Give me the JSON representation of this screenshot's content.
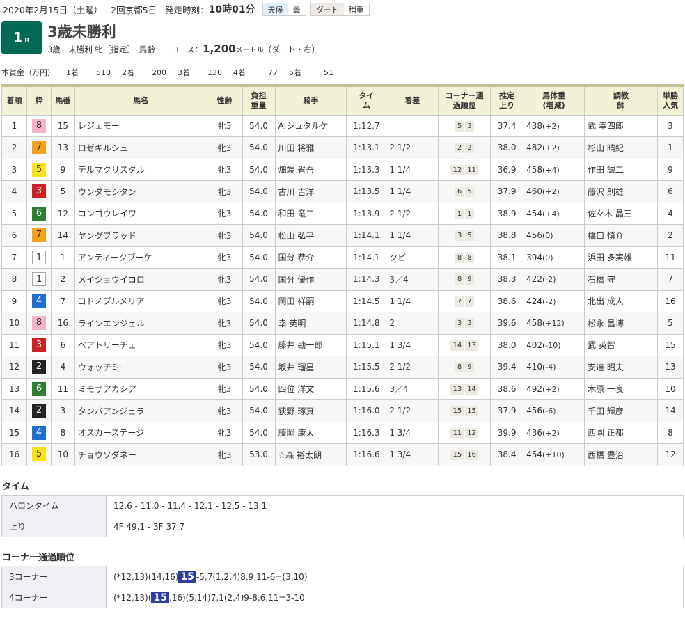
{
  "header": {
    "date": "2020年2月15日（土曜）",
    "meeting": "2回京都5日",
    "start_label": "発走時刻：",
    "start_time": "10時01分",
    "weather_label": "天候",
    "weather": "曇",
    "track_label": "ダート",
    "track_cond": "稍重"
  },
  "race": {
    "number": "1",
    "number_suffix": "R",
    "title": "3歳未勝利",
    "conditions": "3歳　未勝利 牝［指定］　馬齢",
    "course_label": "コース：",
    "distance": "1,200",
    "distance_unit": "メートル",
    "course_detail": "（ダート・右）"
  },
  "prize": {
    "label": "本賞金（万円）",
    "items": [
      {
        "place": "1着",
        "amount": "510"
      },
      {
        "place": "2着",
        "amount": "200"
      },
      {
        "place": "3着",
        "amount": "130"
      },
      {
        "place": "4着",
        "amount": "77"
      },
      {
        "place": "5着",
        "amount": "51"
      }
    ]
  },
  "columns": [
    "着順",
    "枠",
    "馬番",
    "馬名",
    "性齢",
    "負担重量",
    "騎手",
    "タイム",
    "着差",
    "コーナー通過順位",
    "推定上り",
    "馬体重(増減)",
    "調教師",
    "単勝人気"
  ],
  "frame_colors": {
    "1": "#ffffff",
    "2": "#222222",
    "3": "#cc2222",
    "4": "#1e6fd0",
    "5": "#f7e21c",
    "6": "#2e7d32",
    "7": "#f5a11c",
    "8": "#f6b3cb"
  },
  "results": [
    [
      "1",
      "8",
      "15",
      "レジェモー",
      "牝3",
      "54.0",
      "A.シュタルケ",
      "1:12.7",
      "",
      "5",
      "3",
      "37.4",
      "438",
      "(+2)",
      "武 幸四郎",
      "3"
    ],
    [
      "2",
      "7",
      "13",
      "ロゼキルシュ",
      "牝3",
      "54.0",
      "川田 将雅",
      "1:13.1",
      "2 1/2",
      "2",
      "2",
      "38.0",
      "482",
      "(+2)",
      "杉山 晴紀",
      "1"
    ],
    [
      "3",
      "5",
      "9",
      "デルマクリスタル",
      "牝3",
      "54.0",
      "畑端 省吾",
      "1:13.3",
      "1 1/4",
      "12",
      "11",
      "36.9",
      "458",
      "(+4)",
      "作田 誠二",
      "9"
    ],
    [
      "4",
      "3",
      "5",
      "ウンダモシタン",
      "牝3",
      "54.0",
      "古川 吉洋",
      "1:13.5",
      "1 1/4",
      "6",
      "5",
      "37.9",
      "460",
      "(+2)",
      "藤沢 則雄",
      "6"
    ],
    [
      "5",
      "6",
      "12",
      "コンゴウレイワ",
      "牝3",
      "54.0",
      "和田 竜二",
      "1:13.9",
      "2 1/2",
      "1",
      "1",
      "38.9",
      "454",
      "(+4)",
      "佐々木 晶三",
      "4"
    ],
    [
      "6",
      "7",
      "14",
      "ヤングブラッド",
      "牝3",
      "54.0",
      "松山 弘平",
      "1:14.1",
      "1 1/4",
      "3",
      "5",
      "38.8",
      "456",
      "(0)",
      "橋口 慎介",
      "2"
    ],
    [
      "7",
      "1",
      "1",
      "アンティークブーケ",
      "牝3",
      "54.0",
      "国分 恭介",
      "1:14.1",
      "クビ",
      "8",
      "8",
      "38.1",
      "394",
      "(0)",
      "浜田 多実雄",
      "11"
    ],
    [
      "8",
      "1",
      "2",
      "メイショウイコロ",
      "牝3",
      "54.0",
      "国分 優作",
      "1:14.3",
      "3／4",
      "8",
      "9",
      "38.3",
      "422",
      "(-2)",
      "石橋 守",
      "7"
    ],
    [
      "9",
      "4",
      "7",
      "ヨドノプルメリア",
      "牝3",
      "54.0",
      "岡田 祥嗣",
      "1:14.5",
      "1 1/4",
      "7",
      "7",
      "38.6",
      "424",
      "(-2)",
      "北出 成人",
      "16"
    ],
    [
      "10",
      "8",
      "16",
      "ラインエンジェル",
      "牝3",
      "54.0",
      "幸 英明",
      "1:14.8",
      "2",
      "3",
      "3",
      "39.6",
      "458",
      "(+12)",
      "松永 昌博",
      "5"
    ],
    [
      "11",
      "3",
      "6",
      "ベアトリーチェ",
      "牝3",
      "54.0",
      "藤井 勘一郎",
      "1:15.1",
      "1 3/4",
      "14",
      "13",
      "38.0",
      "402",
      "(-10)",
      "武 英智",
      "15"
    ],
    [
      "12",
      "2",
      "4",
      "ウォッチミー",
      "牝3",
      "54.0",
      "坂井 瑠星",
      "1:15.5",
      "2 1/2",
      "8",
      "9",
      "39.4",
      "410",
      "(-4)",
      "安達 昭夫",
      "13"
    ],
    [
      "13",
      "6",
      "11",
      "ミモザアカシア",
      "牝3",
      "54.0",
      "四位 洋文",
      "1:15.6",
      "3／4",
      "13",
      "14",
      "38.6",
      "492",
      "(+2)",
      "木原 一良",
      "10"
    ],
    [
      "14",
      "2",
      "3",
      "タンバアンジェラ",
      "牝3",
      "54.0",
      "荻野 琢真",
      "1:16.0",
      "2 1/2",
      "15",
      "15",
      "37.9",
      "456",
      "(-6)",
      "千田 輝彦",
      "14"
    ],
    [
      "15",
      "4",
      "8",
      "オスカーステージ",
      "牝3",
      "54.0",
      "藤岡 康太",
      "1:16.3",
      "1 3/4",
      "11",
      "12",
      "39.9",
      "436",
      "(+2)",
      "西園 正都",
      "8"
    ],
    [
      "16",
      "5",
      "10",
      "チョウソダネー",
      "牝3",
      "53.0",
      "☆森 裕太朗",
      "1:16.6",
      "1 3/4",
      "15",
      "16",
      "38.4",
      "454",
      "(+10)",
      "西橋 豊治",
      "12"
    ]
  ],
  "time_section": {
    "title": "タイム",
    "rows": [
      {
        "label": "ハロンタイム",
        "value": "12.6 - 11.0 - 11.4 - 12.1 - 12.5 - 13.1"
      },
      {
        "label": "上り",
        "value": "4F 49.1 - 3F 37.7"
      }
    ]
  },
  "corner_section": {
    "title": "コーナー通過順位",
    "rows": [
      {
        "label": "3コーナー",
        "pre": "(*12,13)(14,16)",
        "hl": "15",
        "post": "-5,7(1,2,4)8,9,11-6=(3,10)"
      },
      {
        "label": "4コーナー",
        "pre": "(*12,13)(",
        "hl": "15",
        "post": ",16)(5,14)7,1(2,4)9-8,6,11=3-10"
      }
    ]
  }
}
